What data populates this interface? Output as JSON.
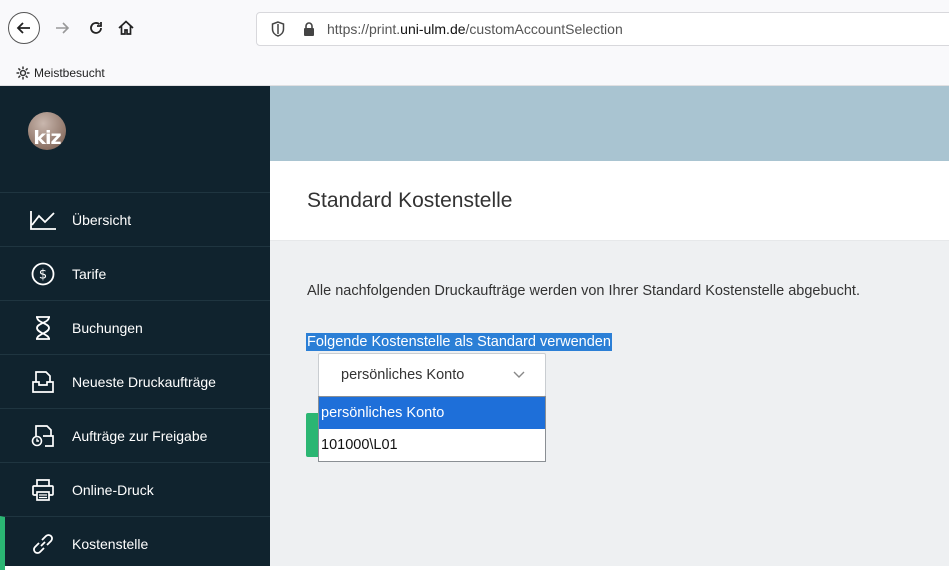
{
  "browser": {
    "url_prefix": "https://print.",
    "url_domain": "uni-ulm.de",
    "url_path": "/customAccountSelection",
    "bookmark": "Meistbesucht"
  },
  "sidebar": {
    "logo_text": "kiz",
    "items": [
      {
        "label": "Übersicht",
        "icon": "chart-line-icon"
      },
      {
        "label": "Tarife",
        "icon": "dollar-circle-icon"
      },
      {
        "label": "Buchungen",
        "icon": "hourglass-icon"
      },
      {
        "label": "Neueste Druckaufträge",
        "icon": "inbox-icon"
      },
      {
        "label": "Aufträge zur Freigabe",
        "icon": "inbox-clock-icon"
      },
      {
        "label": "Online-Druck",
        "icon": "printer-icon"
      },
      {
        "label": "Kostenstelle",
        "icon": "link-icon"
      }
    ],
    "active_index": 6,
    "accent": "#2bb673"
  },
  "main": {
    "title": "Standard Kostenstelle",
    "description": "Alle nachfolgenden Druckaufträge werden von Ihrer Standard Kostenstelle abgebucht.",
    "select_label": "Folgende Kostenstelle als Standard verwenden",
    "select_value": "persönliches Konto",
    "options": [
      "persönliches Konto",
      "101000\\L01"
    ],
    "selected_option_index": 0
  }
}
